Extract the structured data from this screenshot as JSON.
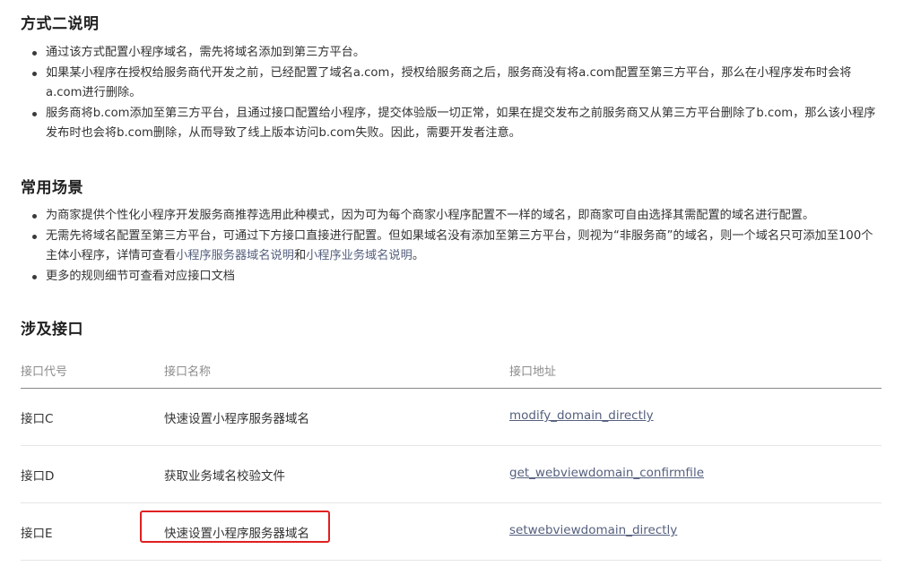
{
  "section1": {
    "title": "方式二说明",
    "bullets": [
      "通过该方式配置小程序域名，需先将域名添加到第三方平台。",
      "如果某小程序在授权给服务商代开发之前，已经配置了域名a.com，授权给服务商之后，服务商没有将a.com配置至第三方平台，那么在小程序发布时会将a.com进行删除。",
      "服务商将b.com添加至第三方平台，且通过接口配置给小程序，提交体验版一切正常，如果在提交发布之前服务商又从第三方平台删除了b.com，那么该小程序发布时也会将b.com删除，从而导致了线上版本访问b.com失败。因此，需要开发者注意。"
    ]
  },
  "section2": {
    "title": "常用场景",
    "bullet1": "为商家提供个性化小程序开发服务商推荐选用此种模式，因为可为每个商家小程序配置不一样的域名，即商家可自由选择其需配置的域名进行配置。",
    "bullet2": {
      "text_before": "无需先将域名配置至第三方平台，可通过下方接口直接进行配置。但如果域名没有添加至第三方平台，则视为“非服务商”的域名，则一个域名只可添加至100个主体小程序，详情可查看",
      "link1": "小程序服务器域名说明",
      "text_mid": "和",
      "link2": "小程序业务域名说明",
      "text_after": "。"
    },
    "bullet3": "更多的规则细节可查看对应接口文档"
  },
  "section3": {
    "title": "涉及接口",
    "headers": [
      "接口代号",
      "接口名称",
      "接口地址"
    ],
    "rows": [
      {
        "code": "接口C",
        "name": "快速设置小程序服务器域名",
        "url": "modify_domain_directly"
      },
      {
        "code": "接口D",
        "name": "获取业务域名校验文件",
        "url": "get_webviewdomain_confirmfile"
      },
      {
        "code": "接口E",
        "name": "快速设置小程序服务器域名",
        "url": "setwebviewdomain_directly"
      }
    ]
  },
  "colors": {
    "text": "#333333",
    "heading": "#1f1f1f",
    "link": "#55607e",
    "header_text": "#8c8c8c",
    "highlight_border": "#e02020"
  }
}
